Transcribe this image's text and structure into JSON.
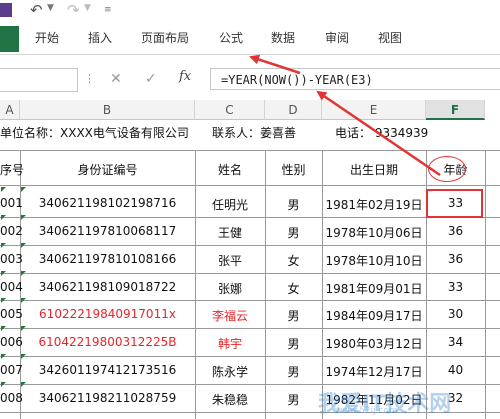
{
  "ribbon": {
    "tabs": [
      "开始",
      "插入",
      "页面布局",
      "公式",
      "数据",
      "审阅",
      "视图"
    ]
  },
  "formula_bar": {
    "cancel_icon": "✕",
    "enter_icon": "✓",
    "fx_label": "fx",
    "formula": "=YEAR(NOW())-YEAR(E3)"
  },
  "columns": [
    "A",
    "B",
    "C",
    "D",
    "E",
    "F"
  ],
  "sheet_info": {
    "unit": "单位名称：XXXX电气设备有限公司",
    "contact": "联系人：姜喜善",
    "phone": "电话：  9334939"
  },
  "table": {
    "headers": [
      "序号",
      "身份证编号",
      "姓名",
      "性别",
      "出生日期",
      "年龄"
    ],
    "rows": [
      {
        "no": "001",
        "id": "340621198102198716",
        "name": "任明光",
        "gender": "男",
        "birth": "1981年02月19日",
        "age": "33",
        "red": false
      },
      {
        "no": "002",
        "id": "340621197810068117",
        "name": "王健",
        "gender": "男",
        "birth": "1978年10月06日",
        "age": "36",
        "red": false
      },
      {
        "no": "003",
        "id": "340621197810108166",
        "name": "张平",
        "gender": "女",
        "birth": "1978年10月10日",
        "age": "36",
        "red": false
      },
      {
        "no": "004",
        "id": "340621198109018722",
        "name": "张娜",
        "gender": "女",
        "birth": "1981年09月01日",
        "age": "33",
        "red": false
      },
      {
        "no": "005",
        "id": "61022219840917011x",
        "name": "李福云",
        "gender": "男",
        "birth": "1984年09月17日",
        "age": "30",
        "red": true
      },
      {
        "no": "006",
        "id": "61042219800312225B",
        "name": "韩宇",
        "gender": "男",
        "birth": "1980年03月12日",
        "age": "34",
        "red": true
      },
      {
        "no": "007",
        "id": "342601197412173516",
        "name": "陈永学",
        "gender": "男",
        "birth": "1974年12月17日",
        "age": "40",
        "red": false
      },
      {
        "no": "008",
        "id": "340621198211028759",
        "name": "朱稳稳",
        "gender": "男",
        "birth": "1982年11月02日",
        "age": "32",
        "red": false
      }
    ]
  },
  "watermark": {
    "text": "我爱IT技术网",
    "sub": "www.52ij.com"
  },
  "colors": {
    "excel_green": "#217346",
    "annotation_red": "#e23434",
    "red_text": "#e8252a"
  }
}
